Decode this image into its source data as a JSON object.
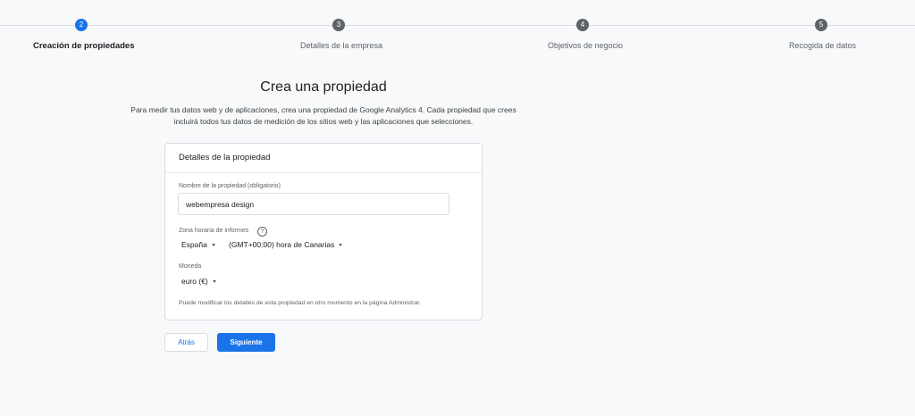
{
  "stepper": {
    "steps": [
      {
        "number": "2",
        "label": "Creación de propiedades",
        "active": true
      },
      {
        "number": "3",
        "label": "Detalles de la empresa",
        "active": false
      },
      {
        "number": "4",
        "label": "Objetivos de negocio",
        "active": false
      },
      {
        "number": "5",
        "label": "Recogida de datos",
        "active": false
      }
    ]
  },
  "header": {
    "title": "Crea una propiedad",
    "intro_line1": "Para medir tus datos web y de aplicaciones, crea una propiedad de Google Analytics 4. Cada propiedad que crees",
    "intro_line2": "incluirá todos tus datos de medición de los sitios web y las aplicaciones que selecciones."
  },
  "card": {
    "title": "Detalles de la propiedad",
    "name_label": "Nombre de la propiedad (obligatorio)",
    "name_value": "webempresa design",
    "timezone_label": "Zona horaria de informes",
    "country": "España",
    "timezone": "(GMT+00:00) hora de Canarias",
    "currency_label": "Moneda",
    "currency": "euro (€)",
    "note": "Puede modificar los detalles de esta propiedad en otro momento en la página Administrar."
  },
  "actions": {
    "back_label": "Atrás",
    "next_label": "Siguiente"
  },
  "colors": {
    "accent": "#1a73e8",
    "inactive_step": "#5f6368",
    "background": "#f8f9fa"
  },
  "icons": {
    "help": "question-circle-icon",
    "dropdown": "caret-down-icon"
  }
}
